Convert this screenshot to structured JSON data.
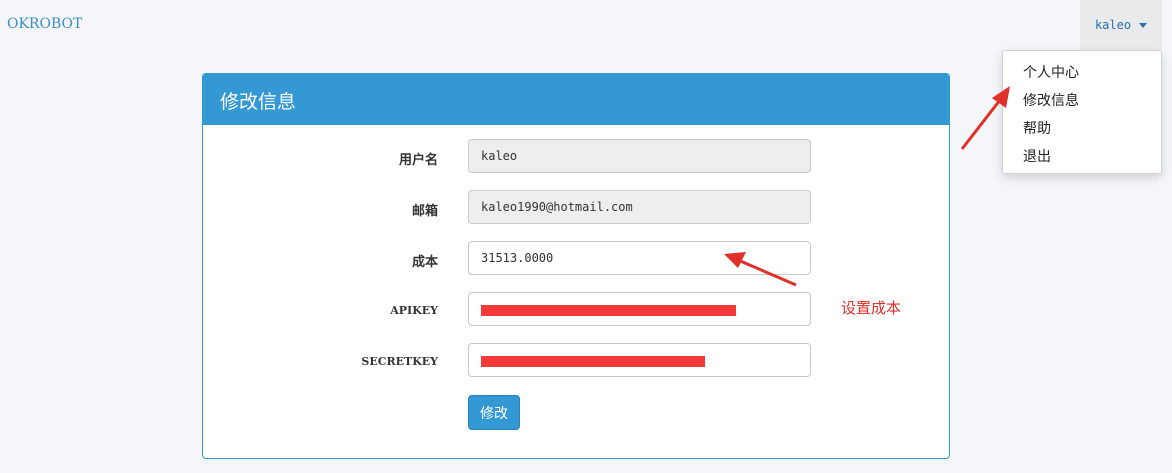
{
  "navbar": {
    "brand": "OKROBOT",
    "user": "kaleo"
  },
  "dropdown": {
    "items": [
      "个人中心",
      "修改信息",
      "帮助",
      "退出"
    ]
  },
  "panel": {
    "title": "修改信息"
  },
  "form": {
    "username_label": "用户名",
    "username_value": "kaleo",
    "email_label": "邮箱",
    "email_value": "kaleo1990@hotmail.com",
    "cost_label": "成本",
    "cost_value": "31513.0000",
    "apikey_label": "APIKEY",
    "secretkey_label": "SECRETKEY",
    "submit_label": "修改"
  },
  "annotation": {
    "text": "设置成本",
    "color": "#e0302a"
  },
  "colors": {
    "accent": "#3398d3",
    "redaction": "#f23a3a"
  }
}
